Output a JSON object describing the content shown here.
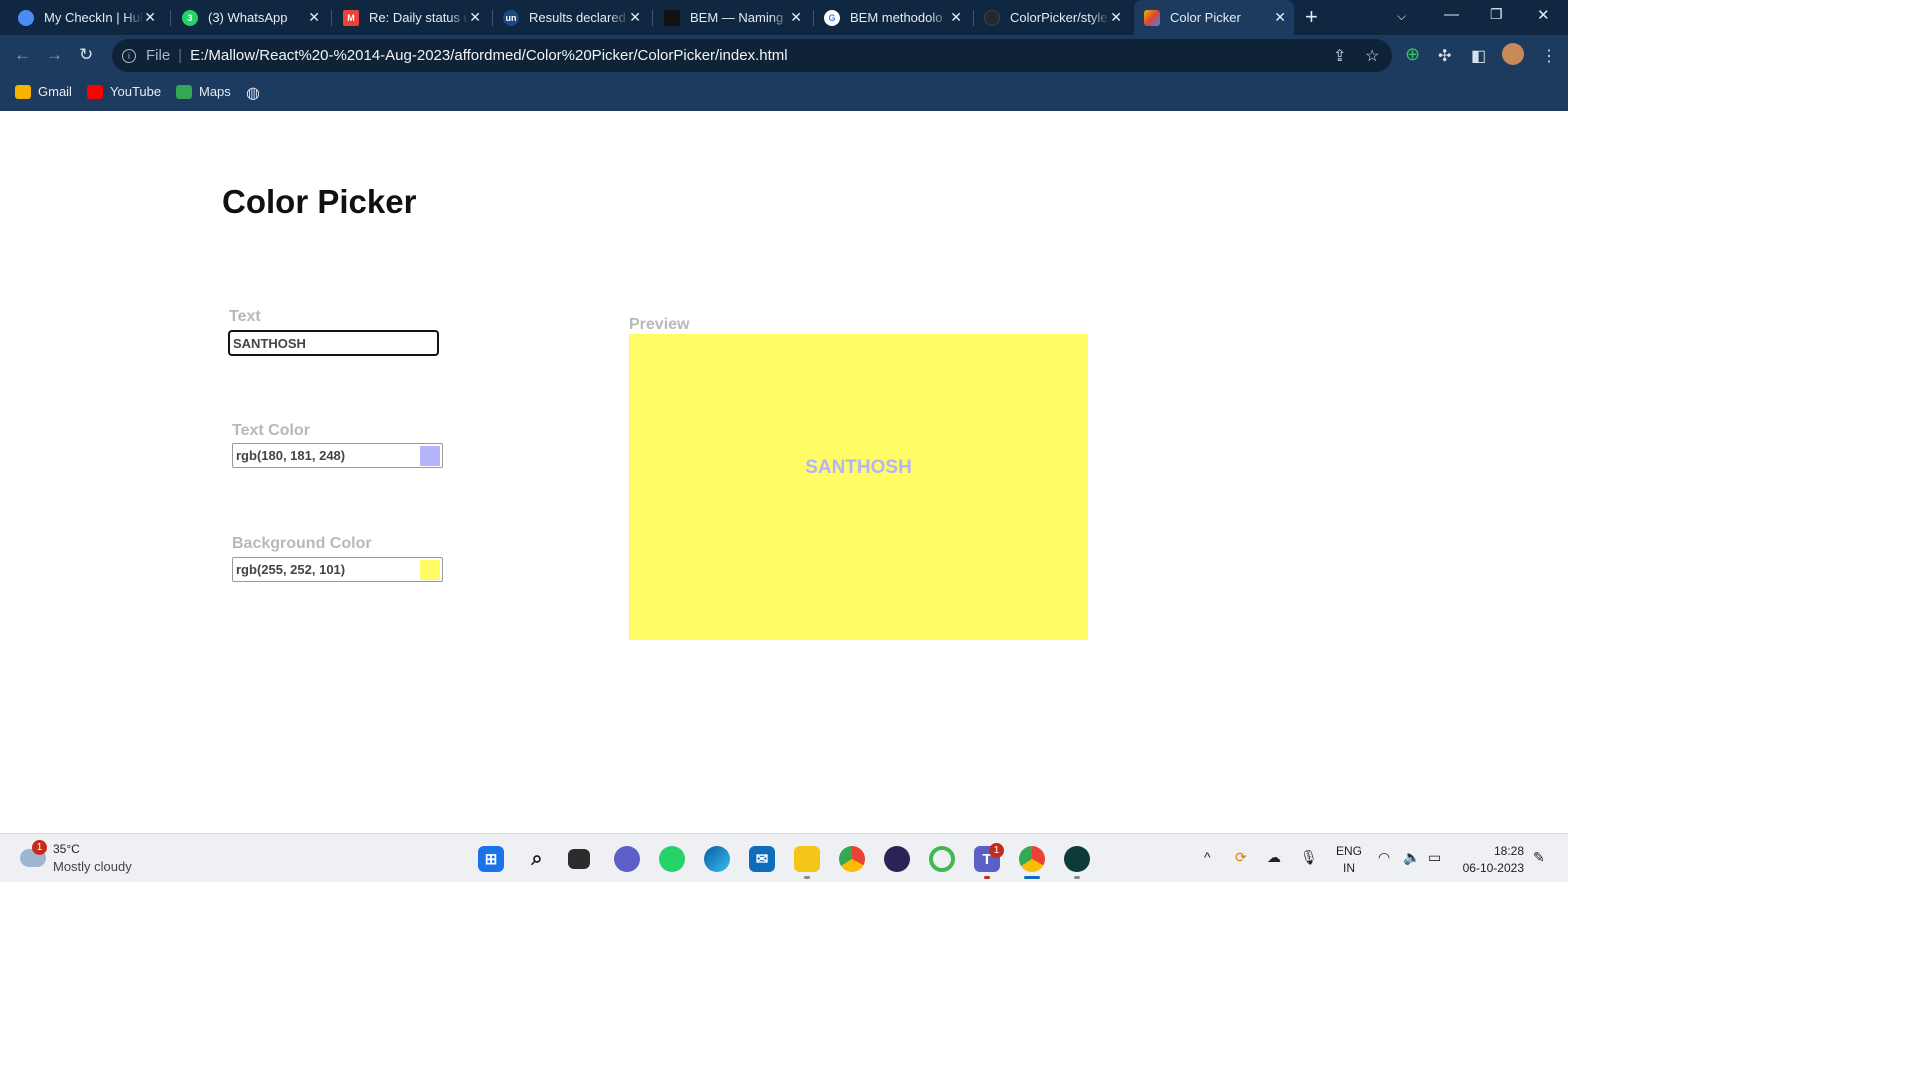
{
  "browser": {
    "tabs": [
      {
        "title": "My CheckIn | Hul",
        "favicon": "hubspot-icon",
        "color": "#4c8bf5"
      },
      {
        "title": "(3) WhatsApp",
        "favicon": "whatsapp-icon",
        "color": "#25d366"
      },
      {
        "title": "Re: Daily status u",
        "favicon": "gmail-icon",
        "color": "#ea4335"
      },
      {
        "title": "Results declared",
        "favicon": "unstop-icon",
        "color": "#1c4980"
      },
      {
        "title": "BEM — Naming",
        "favicon": "bem-icon",
        "color": "#111111"
      },
      {
        "title": "BEM methodolo",
        "favicon": "google-icon",
        "color": "#4285f4"
      },
      {
        "title": "ColorPicker/style",
        "favicon": "github-icon",
        "color": "#24292f"
      },
      {
        "title": "Color Picker",
        "favicon": "colorpicker-icon",
        "color": "#f4b400"
      }
    ],
    "new_tab": "+",
    "address": {
      "scheme_label": "File",
      "url": "E:/Mallow/React%20-%2014-Aug-2023/affordmed/Color%20Picker/ColorPicker/index.html"
    },
    "bookmarks": [
      {
        "label": "Gmail",
        "color": "#f4b400"
      },
      {
        "label": "YouTube",
        "color": "#ff0000"
      },
      {
        "label": "Maps",
        "color": "#34a853"
      }
    ]
  },
  "page": {
    "title": "Color Picker",
    "text_label": "Text",
    "text_value": "SANTHOSH",
    "text_color_label": "Text Color",
    "text_color_value": "rgb(180, 181, 248)",
    "text_color_hex": "#b4b5f8",
    "bg_color_label": "Background Color",
    "bg_color_value": "rgb(255, 252, 101)",
    "bg_color_hex": "#fffc65",
    "preview_label": "Preview",
    "preview_text": "SANTHOSH"
  },
  "taskbar": {
    "weather_badge": "1",
    "temperature": "35°C",
    "weather": "Mostly cloudy",
    "language": "ENG",
    "region": "IN",
    "time": "18:28",
    "date": "06-10-2023",
    "teams_badge": "1"
  }
}
